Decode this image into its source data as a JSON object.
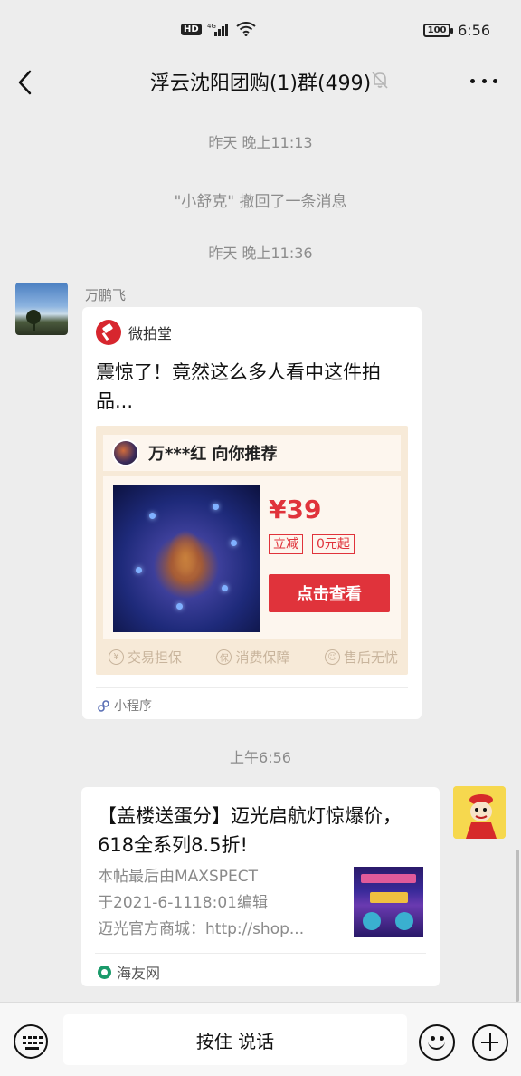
{
  "status_bar": {
    "network": "HD",
    "signal": "4G",
    "battery": "100",
    "time": "6:56"
  },
  "header": {
    "title": "浮云沈阳团购(1)群(499)",
    "back_icon": "chevron-left-icon",
    "mute_icon": "bell-muted-icon",
    "more_icon": "more-dots-icon"
  },
  "messages": {
    "time1": "昨天 晚上11:13",
    "recall_notice": "\"小舒克\" 撤回了一条消息",
    "time2": "昨天 晚上11:36",
    "sender1": "万鹏飞",
    "card1": {
      "app_name": "微拍堂",
      "title": "震惊了！竟然这么多人看中这件拍品...",
      "recommender": "万***红 向你推荐",
      "price": "¥39",
      "tag1": "立减",
      "tag2": "0元起",
      "button": "点击查看",
      "guarantee1": "交易担保",
      "guarantee2": "消费保障",
      "guarantee3": "售后无忧",
      "footer": "小程序"
    },
    "time3": "上午6:56",
    "card2": {
      "title": "【盖楼送蛋分】迈光启航灯惊爆价，618全系列8.5折!",
      "desc_line1": "本帖最后由MAXSPECT",
      "desc_line2": "于2021-6-1118:01编辑",
      "desc_line3": "迈光官方商城：http://shop...",
      "source": "海友网"
    }
  },
  "input_bar": {
    "voice_label": "按住 说话",
    "keyboard_icon": "keyboard-icon",
    "emoji_icon": "emoji-icon",
    "plus_icon": "plus-icon"
  },
  "colors": {
    "background": "#ededed",
    "accent_red": "#e0333b",
    "muted_text": "#8c8c8c"
  }
}
